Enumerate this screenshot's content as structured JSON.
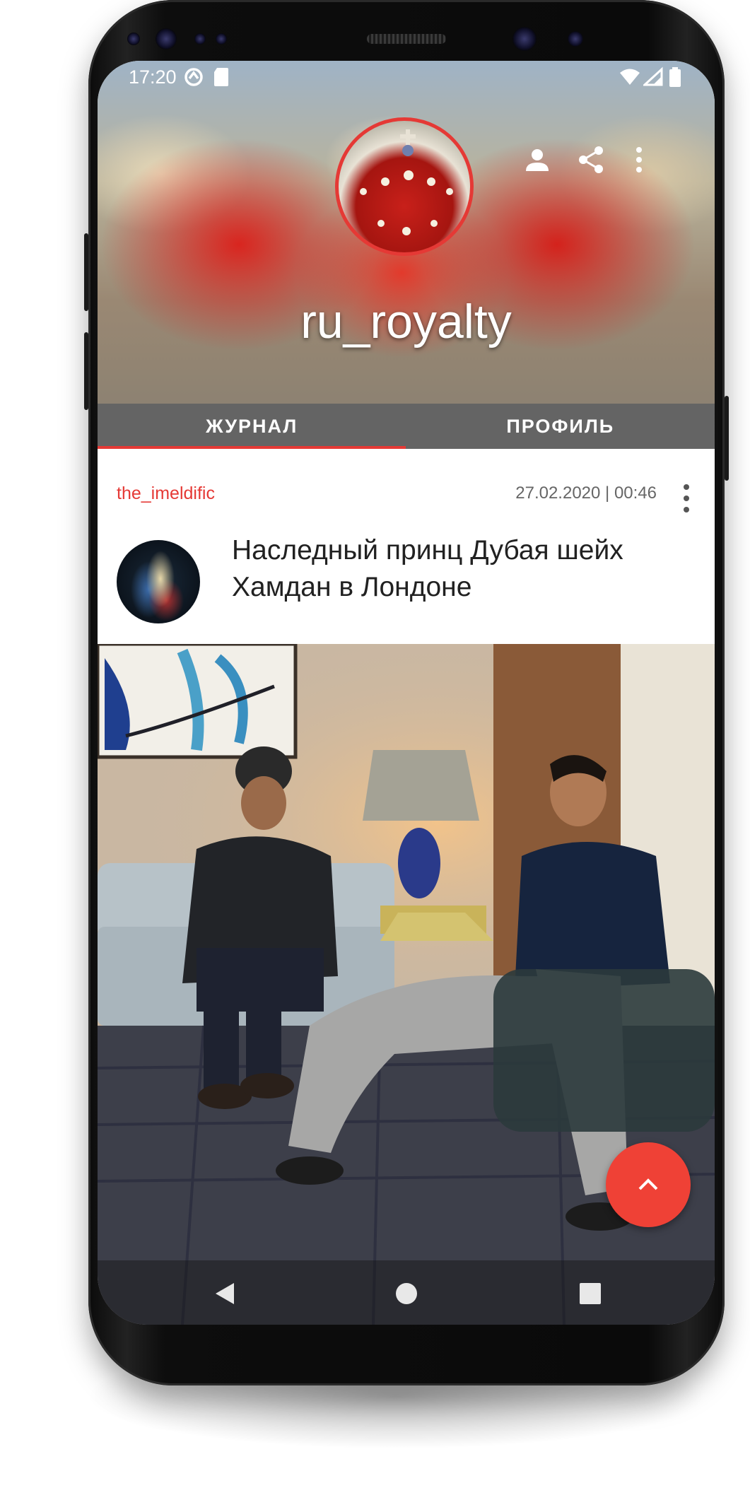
{
  "status_bar": {
    "time": "17:20"
  },
  "header": {
    "channel_title": "ru_royalty",
    "accent_color": "#e53935"
  },
  "tabs": [
    {
      "label": "ЖУРНАЛ",
      "active": true
    },
    {
      "label": "ПРОФИЛЬ",
      "active": false
    }
  ],
  "post": {
    "author": "the_imeldific",
    "date": "27.02.2020 | 00:46",
    "title": "Наследный принц Дубая шейх Хамдан в Лондоне"
  },
  "icons": {
    "header_actions": [
      "person-icon",
      "share-icon",
      "more-vert-icon"
    ],
    "nav": [
      "back-icon",
      "home-icon",
      "recents-icon"
    ],
    "fab": "chevron-up-icon"
  }
}
